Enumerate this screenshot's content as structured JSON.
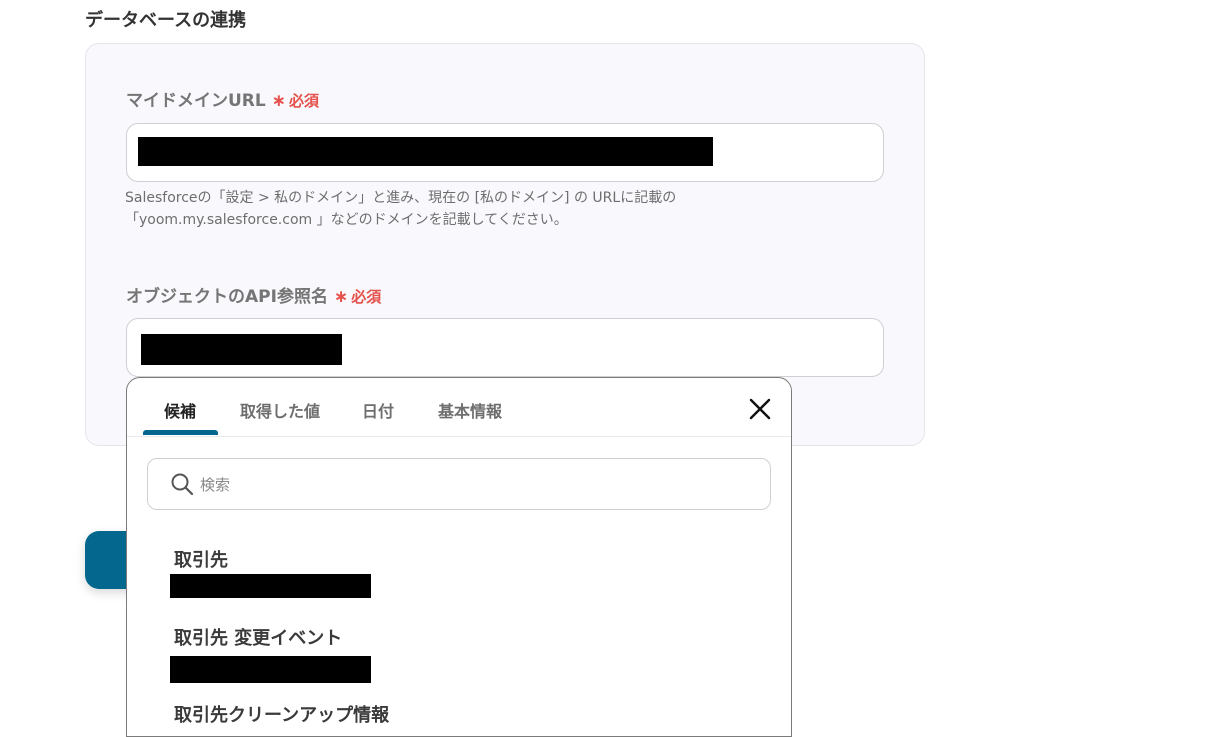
{
  "section": {
    "title": "データベースの連携"
  },
  "fields": {
    "domain": {
      "label": "マイドメインURL",
      "required_star": "∗",
      "required_text": "必須",
      "help_line1": "Salesforceの「設定 > 私のドメイン」と進み、現在の [私のドメイン] の URLに記載の",
      "help_line2": "「yoom.my.salesforce.com 」などのドメインを記載してください。"
    },
    "object": {
      "label": "オブジェクトのAPI参照名",
      "required_star": "∗",
      "required_text": "必須"
    }
  },
  "popup": {
    "tabs": [
      {
        "label": "候補"
      },
      {
        "label": "取得した値"
      },
      {
        "label": "日付"
      },
      {
        "label": "基本情報"
      }
    ],
    "search_placeholder": "検索",
    "options": [
      {
        "label": "取引先"
      },
      {
        "label": "取引先 変更イベント"
      },
      {
        "label": "取引先クリーンアップ情報"
      }
    ]
  },
  "colors": {
    "accent": "#04678d",
    "required": "#e5504a"
  }
}
